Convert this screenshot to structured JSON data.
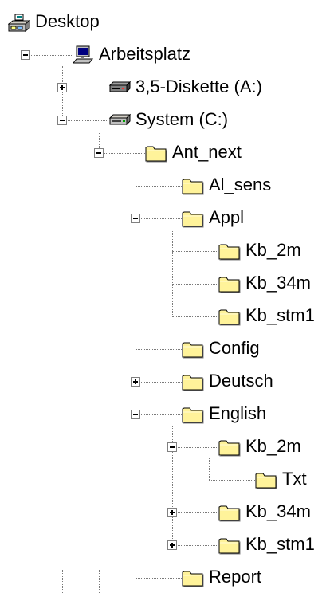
{
  "tree": [
    {
      "label": "Desktop",
      "icon": "desktop-icon",
      "depth": 0,
      "toggle": "none"
    },
    {
      "label": "Arbeitsplatz",
      "icon": "computer-icon",
      "depth": 1,
      "toggle": "minus"
    },
    {
      "label": "3,5-Diskette (A:)",
      "icon": "floppy-drive-icon",
      "depth": 2,
      "toggle": "plus"
    },
    {
      "label": "System (C:)",
      "icon": "hard-drive-icon",
      "depth": 2,
      "toggle": "minus"
    },
    {
      "label": "Ant_next",
      "icon": "folder-icon",
      "depth": 3,
      "toggle": "minus"
    },
    {
      "label": "Al_sens",
      "icon": "folder-icon",
      "depth": 4,
      "toggle": "none"
    },
    {
      "label": "Appl",
      "icon": "folder-icon",
      "depth": 4,
      "toggle": "minus"
    },
    {
      "label": "Kb_2m",
      "icon": "folder-icon",
      "depth": 5,
      "toggle": "none"
    },
    {
      "label": "Kb_34m",
      "icon": "folder-icon",
      "depth": 5,
      "toggle": "none"
    },
    {
      "label": "Kb_stm1",
      "icon": "folder-icon",
      "depth": 5,
      "toggle": "none"
    },
    {
      "label": "Config",
      "icon": "folder-icon",
      "depth": 4,
      "toggle": "none"
    },
    {
      "label": "Deutsch",
      "icon": "folder-icon",
      "depth": 4,
      "toggle": "plus"
    },
    {
      "label": "English",
      "icon": "folder-icon",
      "depth": 4,
      "toggle": "minus"
    },
    {
      "label": "Kb_2m",
      "icon": "folder-icon",
      "depth": 5,
      "toggle": "minus"
    },
    {
      "label": "Txt",
      "icon": "folder-icon",
      "depth": 6,
      "toggle": "none"
    },
    {
      "label": "Kb_34m",
      "icon": "folder-icon",
      "depth": 5,
      "toggle": "plus"
    },
    {
      "label": "Kb_stm1",
      "icon": "folder-icon",
      "depth": 5,
      "toggle": "plus"
    },
    {
      "label": "Report",
      "icon": "folder-icon",
      "depth": 4,
      "toggle": "none"
    }
  ]
}
